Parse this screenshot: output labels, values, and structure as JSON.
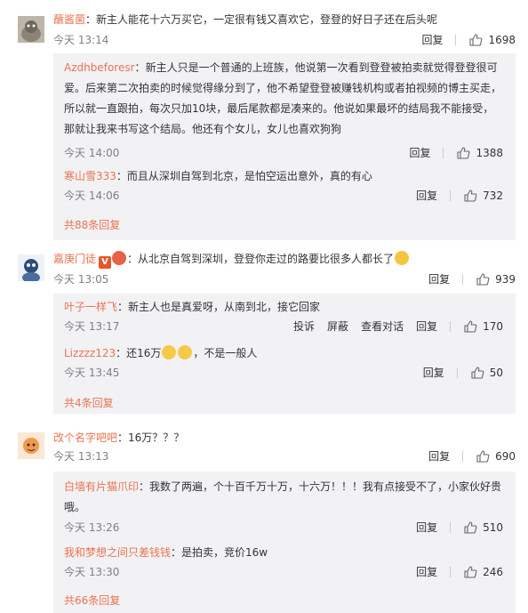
{
  "labels": {
    "reply": "回复",
    "report": "投诉",
    "block": "屏蔽",
    "view_thread": "查看对话"
  },
  "threads": [
    {
      "user": "蘸酱菌",
      "text": "新主人能花十六万买它，一定很有钱又喜欢它，登登的好日子还在后头呢",
      "time": "今天 13:14",
      "likes": "1698",
      "replies": [
        {
          "user": "Azdhbeforesr",
          "text": "新主人只是一个普通的上班族，他说第一次看到登登被拍卖就觉得登登很可爱。后来第二次拍卖的时候觉得缘分到了，他不希望登登被赚钱机构或者拍视频的博主买走，所以就一直跟拍，每次只加10块，最后尾款都是凑来的。他说如果最坏的结局我不能接受，那就让我来书写这个结局。他还有个女儿，女儿也喜欢狗狗",
          "time": "今天 14:00",
          "likes": "1388"
        },
        {
          "user": "寒山雪333",
          "text": "而且从深圳自驾到北京，是怕空运出意外，真的有心",
          "time": "今天 14:06",
          "likes": "732"
        }
      ],
      "more": "共88条回复"
    },
    {
      "user": "嘉庚门徒",
      "text": "从北京自驾到深圳，登登你走过的路要比很多人都长了",
      "time": "今天 13:05",
      "likes": "939",
      "replies": [
        {
          "user": "叶子一样飞",
          "text": "新主人也是真爱呀，从南到北，接它回家",
          "time": "今天 13:17",
          "likes": "170"
        },
        {
          "user": "Lizzzz123",
          "text_a": "还16万",
          "text_b": "，不是一般人",
          "time": "今天 13:45",
          "likes": "50"
        }
      ],
      "more": "共4条回复"
    },
    {
      "user": "改个名字吧吧",
      "text": "16万？？？",
      "time": "今天 13:13",
      "likes": "690",
      "replies": [
        {
          "user": "白墙有片猫爪印",
          "text": "我数了两遍，个十百千万十万，十六万！！！我有点接受不了，小家伙好贵哦。",
          "time": "今天 13:26",
          "likes": "510"
        },
        {
          "user": "我和梦想之间只差钱钱",
          "text": "是拍卖，竞价16w",
          "time": "今天 13:30",
          "likes": "246"
        }
      ],
      "more": "共66条回复"
    }
  ]
}
